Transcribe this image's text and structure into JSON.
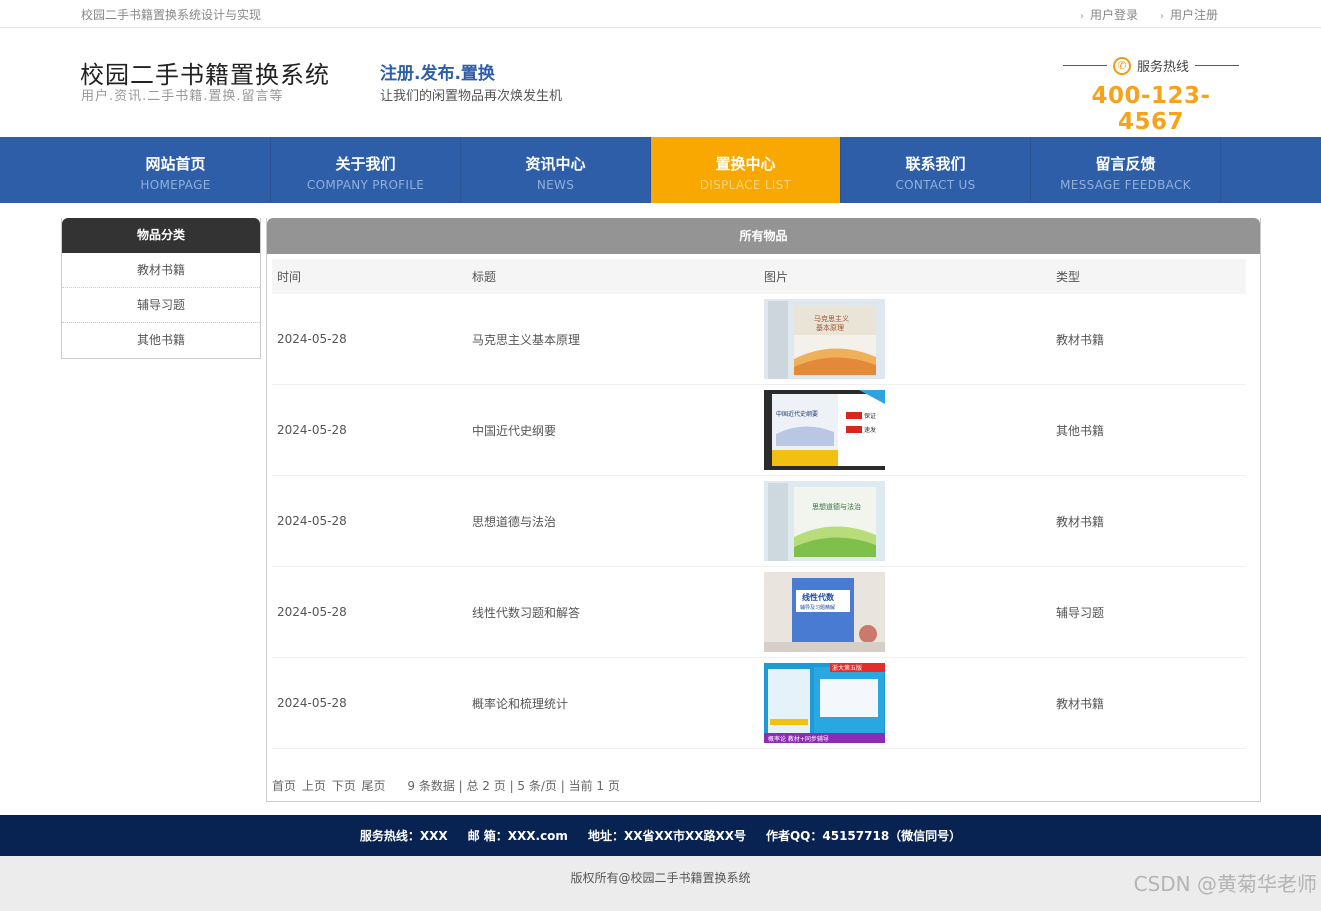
{
  "topbar": {
    "caption": "校园二手书籍置换系统设计与实现",
    "login": "用户登录",
    "register": "用户注册"
  },
  "header": {
    "brand_name": "校园二手书籍置换系统",
    "brand_sub": "用户.资讯.二手书籍.置换.留言等",
    "slogan_title": "注册.发布.置换",
    "slogan_sub": "让我们的闲置物品再次焕发生机",
    "hotline_label": "服务热线",
    "hotline_number": "400-123-4567"
  },
  "nav": [
    {
      "cn": "网站首页",
      "en": "HOMEPAGE"
    },
    {
      "cn": "关于我们",
      "en": "COMPANY PROFILE"
    },
    {
      "cn": "资讯中心",
      "en": "NEWS"
    },
    {
      "cn": "置换中心",
      "en": "DISPLACE LIST"
    },
    {
      "cn": "联系我们",
      "en": "CONTACT US"
    },
    {
      "cn": "留言反馈",
      "en": "MESSAGE FEEDBACK"
    }
  ],
  "sidebar": {
    "title": "物品分类",
    "items": [
      "教材书籍",
      "辅导习题",
      "其他书籍"
    ]
  },
  "main": {
    "title": "所有物品",
    "headers": [
      "时间",
      "标题",
      "图片",
      "类型"
    ],
    "rows": [
      {
        "date": "2024-05-28",
        "title": "马克思主义基本原理",
        "type": "教材书籍"
      },
      {
        "date": "2024-05-28",
        "title": "中国近代史纲要",
        "type": "其他书籍"
      },
      {
        "date": "2024-05-28",
        "title": "思想道德与法治",
        "type": "教材书籍"
      },
      {
        "date": "2024-05-28",
        "title": "线性代数习题和解答",
        "type": "辅导习题"
      },
      {
        "date": "2024-05-28",
        "title": "概率论和梳理统计",
        "type": "教材书籍"
      }
    ],
    "pager": {
      "first": "首页",
      "prev": "上页",
      "next": "下页",
      "last": "尾页",
      "info": "9 条数据 | 总 2 页 | 5 条/页 | 当前 1 页"
    }
  },
  "footer": {
    "hotline": "服务热线：XXX",
    "email": "邮 箱：XXX.com",
    "address": "地址：XX省XX市XX路XX号",
    "qq": "作者QQ：45157718（微信同号）",
    "copyright": "版权所有@校园二手书籍置换系统",
    "watermark": "CSDN @黄菊华老师"
  },
  "colors": {
    "nav_bg": "#2e5ea8",
    "nav_active": "#f8a800",
    "hotline": "#f6a21c",
    "footer_bg": "#082351"
  }
}
